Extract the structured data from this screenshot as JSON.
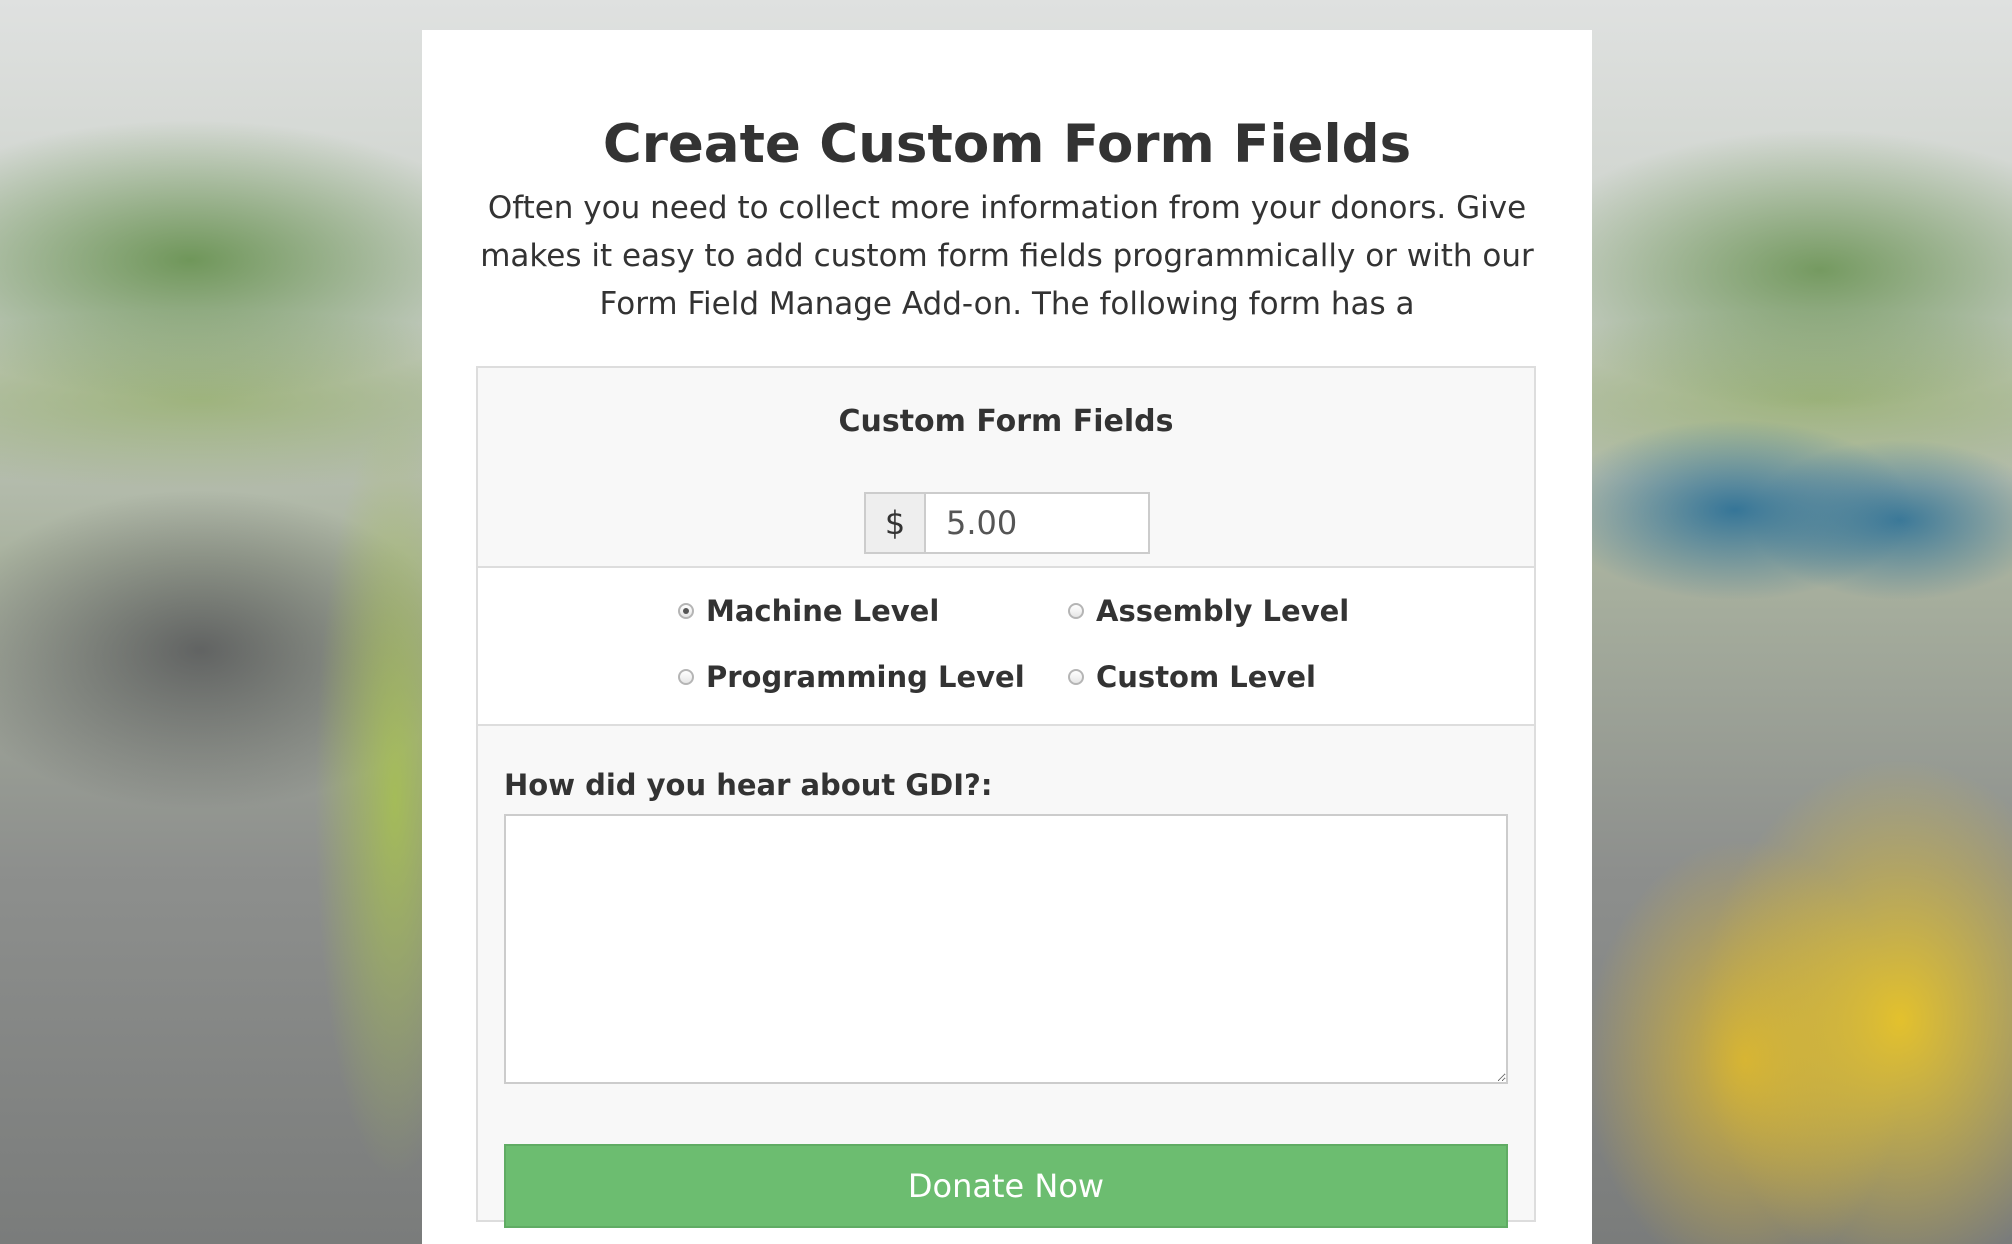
{
  "page": {
    "title": "Create Custom Form Fields",
    "intro": "Often you need to collect more information from your donors. Give makes it easy to add custom form fields programmically or with our Form Field Manage Add-on. The following form has a"
  },
  "form": {
    "title": "Custom Form Fields",
    "currency_symbol": "$",
    "amount_value": "5.00",
    "levels": [
      {
        "label": "Machine Level",
        "checked": true
      },
      {
        "label": "Assembly Level",
        "checked": false
      },
      {
        "label": "Programming Level",
        "checked": false
      },
      {
        "label": "Custom Level",
        "checked": false
      }
    ],
    "hear_label": "How did you hear about GDI?:",
    "hear_value": "",
    "submit_label": "Donate Now"
  },
  "colors": {
    "button_green": "#6cbd70",
    "text": "#333333",
    "panel_bg": "#f8f8f8"
  }
}
